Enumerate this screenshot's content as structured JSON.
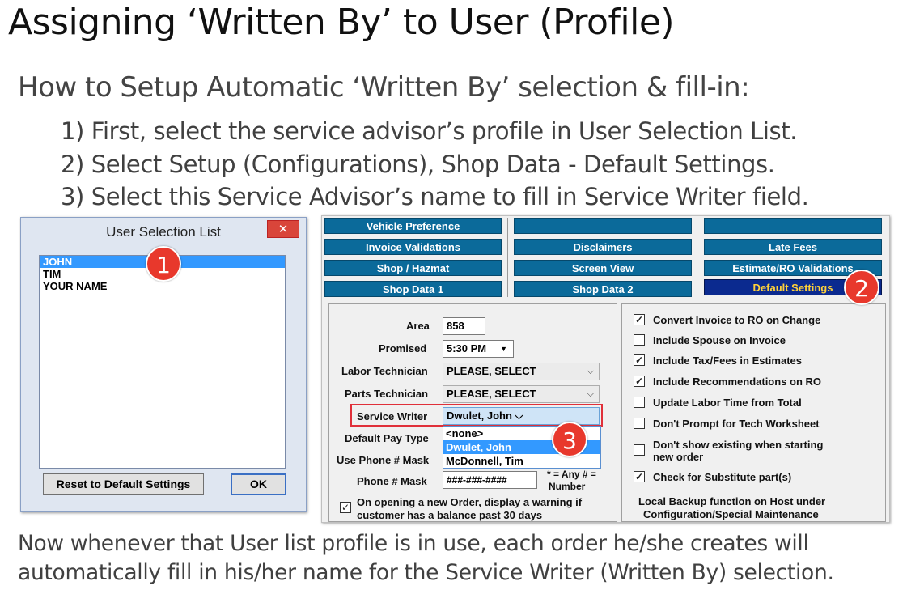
{
  "slide": {
    "title": "Assigning ‘Written By’ to  User (Profile)",
    "subtitle": "How to Setup Automatic ‘Written By’ selection & fill-in:",
    "steps": [
      "1) First, select the service advisor’s profile in User Selection List.",
      "2) Select Setup (Configurations), Shop Data - Default Settings.",
      "3) Select this Service Advisor’s name to fill in Service Writer field."
    ],
    "footer_line1": "Now whenever that User list profile is in use, each order he/she creates will",
    "footer_line2": "automatically fill in his/her name for the Service Writer (Written By) selection.",
    "badges": [
      "1",
      "2",
      "3"
    ],
    "badge_color": "#e8382c"
  },
  "user_selection": {
    "title": "User Selection List",
    "close_label": "✕",
    "users": [
      "JOHN",
      "TIM",
      "YOUR NAME"
    ],
    "selected_user": "JOHN",
    "reset_label": "Reset to Default Settings",
    "ok_label": "OK",
    "selection_color": "#3399ff"
  },
  "settings": {
    "tabs": {
      "col1": [
        "Vehicle Preference",
        "Invoice Validations",
        "Shop / Hazmat",
        "Shop Data 1"
      ],
      "col2": [
        "",
        "Disclaimers",
        "Screen View",
        "Shop Data 2"
      ],
      "col3": [
        "",
        "Late Fees",
        "Estimate/RO Validations",
        "Default Settings"
      ]
    },
    "active_tab": "Default Settings",
    "tab_color": "#0b6a9a",
    "active_tab_color": "#0b2a8f",
    "area": {
      "label": "Area",
      "value": "858"
    },
    "promised": {
      "label": "Promised",
      "value": "5:30 PM"
    },
    "labor_technician": {
      "label": "Labor Technician",
      "value": "PLEASE, SELECT"
    },
    "parts_technician": {
      "label": "Parts Technician",
      "value": "PLEASE, SELECT"
    },
    "service_writer": {
      "label": "Service Writer",
      "value": "Dwulet, John"
    },
    "service_writer_options": [
      "<none>",
      "Dwulet, John",
      "McDonnell, Tim"
    ],
    "default_pay_type": {
      "label": "Default Pay Type"
    },
    "use_phone_mask": {
      "label": "Use Phone # Mask"
    },
    "phone_mask": {
      "label": "Phone # Mask",
      "value": "###-###-####",
      "hint_line1": "* = Any # =",
      "hint_line2": "Number"
    },
    "balance_warning": {
      "line1": "On opening a new Order, display a warning if",
      "line2": "customer has a balance past 30 days",
      "checked": true
    },
    "options": [
      {
        "label": "Convert Invoice to RO on Change",
        "checked": true
      },
      {
        "label": "Include Spouse on Invoice",
        "checked": false
      },
      {
        "label": "Include Tax/Fees in Estimates",
        "checked": true
      },
      {
        "label": "Include Recommendations on RO",
        "checked": true
      },
      {
        "label": "Update Labor Time from Total",
        "checked": false
      },
      {
        "label": "Don't Prompt for Tech Worksheet",
        "checked": false
      },
      {
        "label": "Don't show existing when starting",
        "label2": "new order",
        "checked": false
      },
      {
        "label": "Check for Substitute part(s)",
        "checked": true
      }
    ],
    "backup_note_line1": "Local Backup function on Host under",
    "backup_note_line2": "Configuration/Special Maintenance",
    "check_mark": "✓",
    "dropdown_arrow": "⌵"
  }
}
